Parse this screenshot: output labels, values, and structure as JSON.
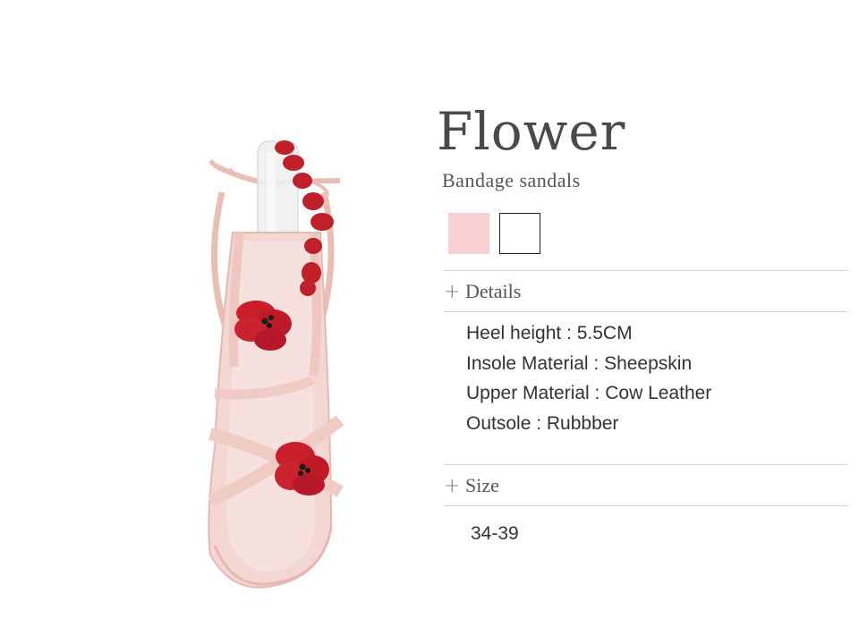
{
  "product": {
    "title": "Flower",
    "subtitle": "Bandage sandals",
    "image_alt": "Pink strappy sandal with red flower appliques",
    "colors": [
      {
        "name": "pink",
        "hex": "#f9d0d2"
      },
      {
        "name": "white",
        "hex": "#ffffff"
      }
    ]
  },
  "details": {
    "header_icon": "plus-icon",
    "header_label": "Details",
    "items": [
      "Heel height : 5.5CM",
      "Insole Material : Sheepskin",
      "Upper Material : Cow Leather",
      "Outsole : Rubbber"
    ]
  },
  "size": {
    "header_icon": "plus-icon",
    "header_label": "Size",
    "value": "34-39"
  }
}
